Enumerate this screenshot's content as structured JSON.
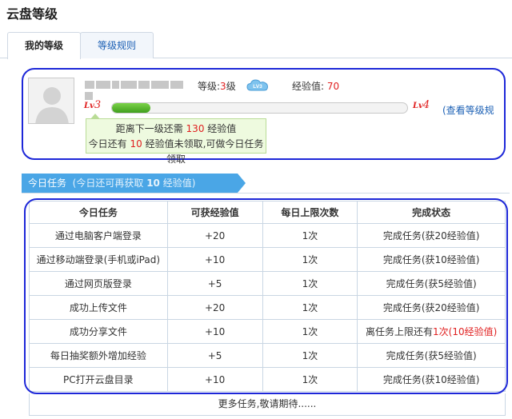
{
  "page_title": "云盘等级",
  "tabs": [
    {
      "label": "我的等级",
      "active": true
    },
    {
      "label": "等级规则",
      "active": false
    }
  ],
  "profile": {
    "avatar_icon": "default-user-avatar",
    "username_masked": true,
    "level_label": "等级:",
    "level_value": "3",
    "level_unit": "级",
    "level_badge_icon": "cloud-lv3-badge",
    "level_badge_text": "LV3",
    "exp_label": "经验值:",
    "exp_value": "70",
    "current_level_mark": {
      "prefix": "Lv",
      "num": "3"
    },
    "next_level_mark": {
      "prefix": "Lv",
      "num": "4"
    },
    "progress_fraction": 0.13,
    "view_levels_link": "(查看等级规",
    "tooltip": {
      "line1_pre": "距离下一级还需",
      "line1_num": "130",
      "line1_post": "经验值",
      "line2_pre": "今日还有",
      "line2_num": "10",
      "line2_post": "经验值未领取,可做今日任务领取"
    }
  },
  "task_banner": {
    "title": "今日任务",
    "sub_pre": "(今日还可再获取",
    "sub_num": "10",
    "sub_post": "经验值)"
  },
  "task_table": {
    "headers": [
      "今日任务",
      "可获经验值",
      "每日上限次数",
      "完成状态"
    ],
    "rows": [
      {
        "task": "通过电脑客户端登录",
        "exp": "+20",
        "limit": "1次",
        "status": "完成任务(获20经验值)",
        "pending": false
      },
      {
        "task": "通过移动端登录(手机或iPad)",
        "exp": "+10",
        "limit": "1次",
        "status": "完成任务(获10经验值)",
        "pending": false
      },
      {
        "task": "通过网页版登录",
        "exp": "+5",
        "limit": "1次",
        "status": "完成任务(获5经验值)",
        "pending": false
      },
      {
        "task": "成功上传文件",
        "exp": "+20",
        "limit": "1次",
        "status": "完成任务(获20经验值)",
        "pending": false
      },
      {
        "task": "成功分享文件",
        "exp": "+10",
        "limit": "1次",
        "status_pre": "离任务上限还有",
        "status_red": "1次(10经验值)",
        "pending": true
      },
      {
        "task": "每日抽奖额外增加经验",
        "exp": "+5",
        "limit": "1次",
        "status": "完成任务(获5经验值)",
        "pending": false
      },
      {
        "task": "PC打开云盘目录",
        "exp": "+10",
        "limit": "1次",
        "status": "完成任务(获10经验值)",
        "pending": false
      }
    ],
    "footer": "更多任务,敬请期待......"
  },
  "colors": {
    "accent_blue": "#4aa6e6",
    "highlight_red": "#e02020",
    "progress_green": "#3fa01c",
    "annotation_outline": "#1d27d8"
  }
}
